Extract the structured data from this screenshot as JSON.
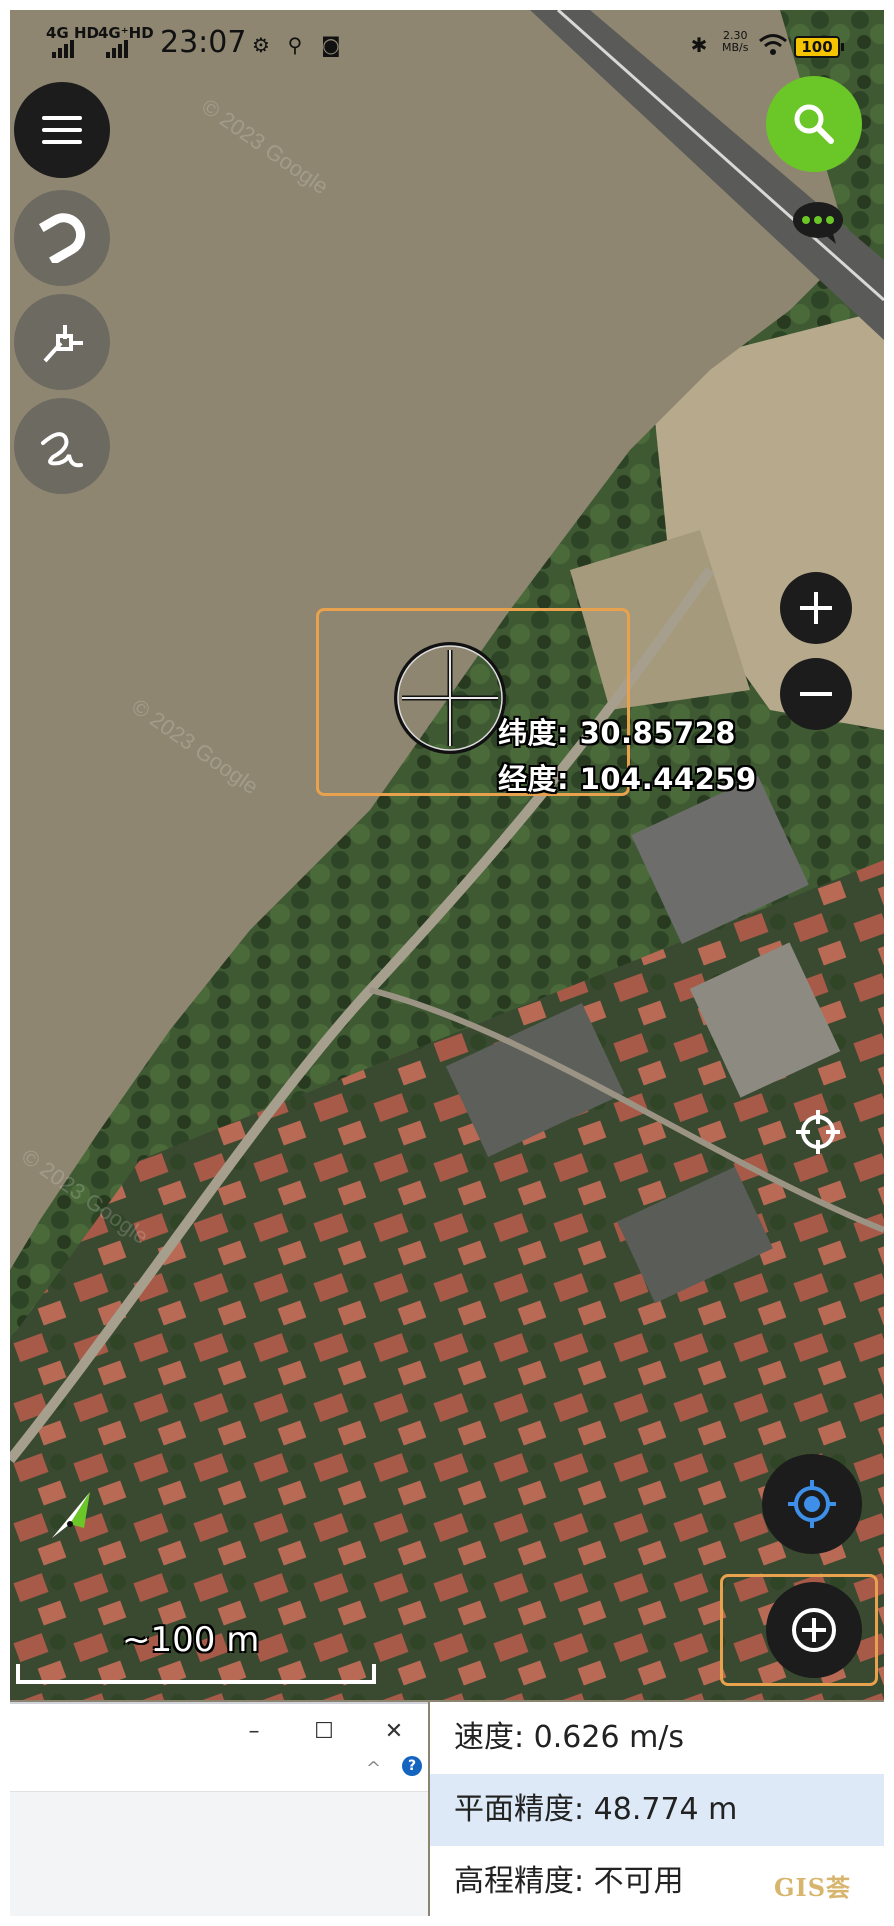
{
  "status_bar": {
    "net1": "4G HD",
    "net2": "4G⁺HD",
    "time": "23:07",
    "speed_value": "2.30",
    "speed_unit": "MB/s",
    "battery": "100"
  },
  "map": {
    "watermark": "© 2023 Google",
    "latitude_label": "纬度: 30.85728",
    "longitude_label": "经度: 104.44259",
    "scale_label": "~100 m"
  },
  "stats": {
    "speed": "速度: 0.626 m/s",
    "horizontal_accuracy": "平面精度: 48.774 m",
    "vertical_accuracy": "高程精度: 不可用"
  },
  "window_controls": {
    "minimize": "–",
    "maximize": "☐",
    "close": "✕",
    "collapse": "^",
    "help": "?"
  },
  "brand_watermark": "GIS荟",
  "colors": {
    "search_button": "#6bc627",
    "highlight": "#e8a14d",
    "locate_icon": "#3d8fe8"
  }
}
